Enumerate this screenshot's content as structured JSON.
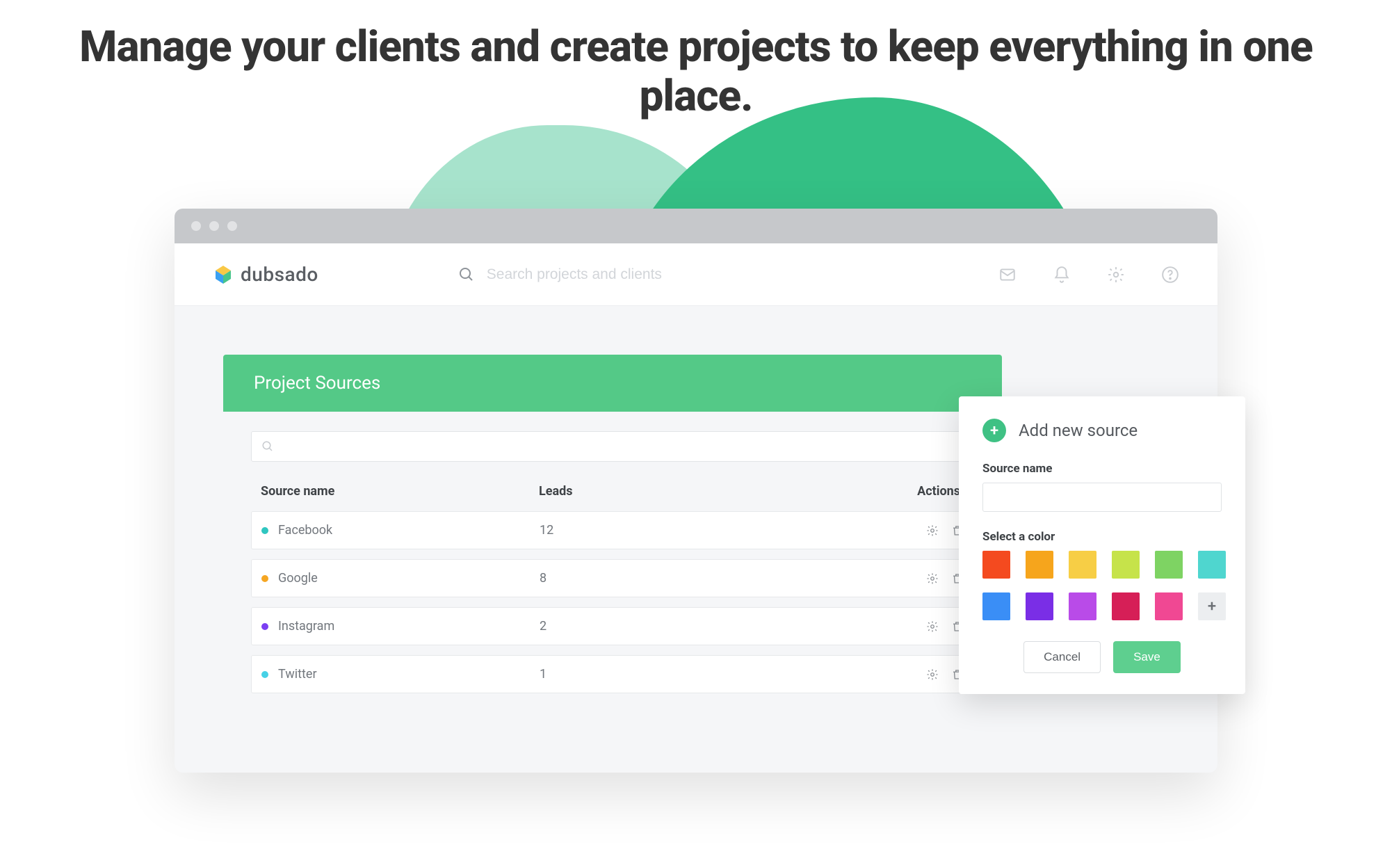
{
  "hero": {
    "title": "Manage your clients and create projects to keep everything in one place."
  },
  "header": {
    "brand": "dubsado",
    "search_placeholder": "Search projects and clients"
  },
  "panel": {
    "title": "Project Sources"
  },
  "table": {
    "columns": {
      "source": "Source name",
      "leads": "Leads",
      "actions": "Actions"
    },
    "rows": [
      {
        "name": "Facebook",
        "leads": "12",
        "dot": "#2fc6c0"
      },
      {
        "name": "Google",
        "leads": "8",
        "dot": "#f5a623"
      },
      {
        "name": "Instagram",
        "leads": "2",
        "dot": "#7b3ff2"
      },
      {
        "name": "Twitter",
        "leads": "1",
        "dot": "#46d1e6"
      }
    ]
  },
  "side": {
    "title": "Add new source",
    "source_label": "Source name",
    "color_label": "Select a color",
    "cancel": "Cancel",
    "save": "Save",
    "colors": [
      "#f44a1f",
      "#f6a51c",
      "#f7ce45",
      "#c6e34a",
      "#7ed363",
      "#4fd6cf",
      "#3a8ef6",
      "#7a2ee6",
      "#b94be8",
      "#d61f57",
      "#f04893"
    ]
  }
}
